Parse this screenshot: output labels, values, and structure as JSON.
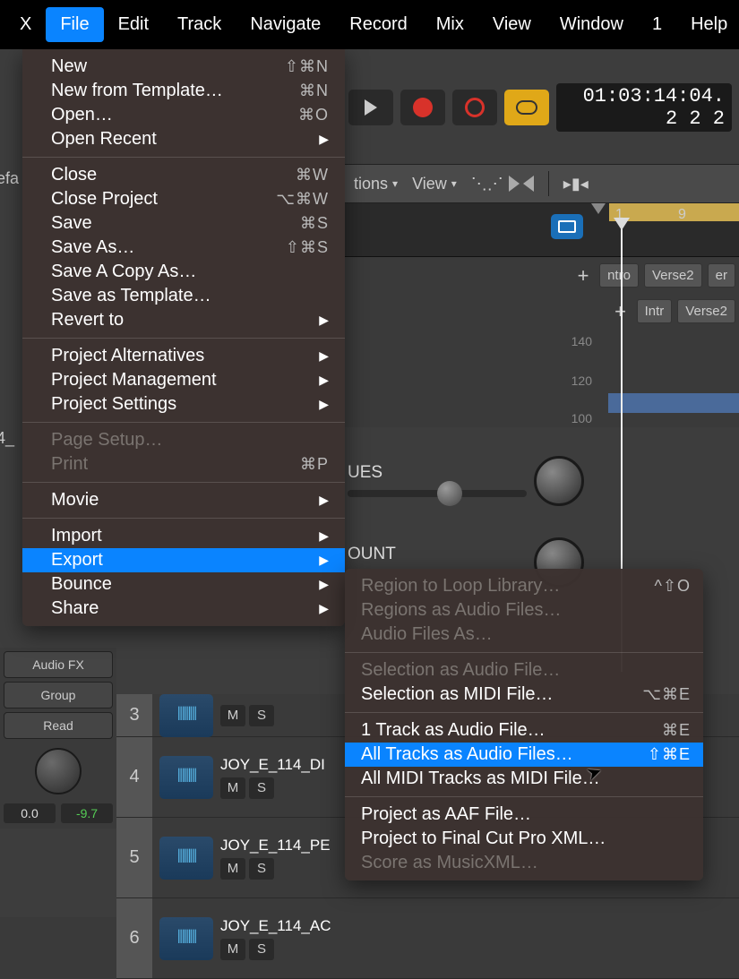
{
  "menubar": {
    "items": [
      "X",
      "File",
      "Edit",
      "Track",
      "Navigate",
      "Record",
      "Mix",
      "View",
      "Window",
      "1",
      "Help"
    ],
    "active_index": 1
  },
  "file_menu": {
    "groups": [
      [
        {
          "label": "New",
          "shortcut": "⇧⌘N"
        },
        {
          "label": "New from Template…",
          "shortcut": "⌘N"
        },
        {
          "label": "Open…",
          "shortcut": "⌘O"
        },
        {
          "label": "Open Recent",
          "submenu": true
        }
      ],
      [
        {
          "label": "Close",
          "shortcut": "⌘W"
        },
        {
          "label": "Close Project",
          "shortcut": "⌥⌘W"
        },
        {
          "label": "Save",
          "shortcut": "⌘S"
        },
        {
          "label": "Save As…",
          "shortcut": "⇧⌘S"
        },
        {
          "label": "Save A Copy As…"
        },
        {
          "label": "Save as Template…"
        },
        {
          "label": "Revert to",
          "submenu": true
        }
      ],
      [
        {
          "label": "Project Alternatives",
          "submenu": true
        },
        {
          "label": "Project Management",
          "submenu": true
        },
        {
          "label": "Project Settings",
          "submenu": true
        }
      ],
      [
        {
          "label": "Page Setup…",
          "disabled": true
        },
        {
          "label": "Print",
          "shortcut": "⌘P",
          "disabled": true
        }
      ],
      [
        {
          "label": "Movie",
          "submenu": true
        }
      ],
      [
        {
          "label": "Import",
          "submenu": true
        },
        {
          "label": "Export",
          "submenu": true,
          "highlighted": true
        },
        {
          "label": "Bounce",
          "submenu": true
        },
        {
          "label": "Share",
          "submenu": true
        }
      ]
    ]
  },
  "export_submenu": {
    "groups": [
      [
        {
          "label": "Region to Loop Library…",
          "shortcut": "^⇧O",
          "disabled": true
        },
        {
          "label": "Regions as Audio Files…",
          "disabled": true
        },
        {
          "label": "Audio Files As…",
          "disabled": true
        }
      ],
      [
        {
          "label": "Selection as Audio File…",
          "disabled": true
        },
        {
          "label": "Selection as MIDI File…",
          "shortcut": "⌥⌘E"
        }
      ],
      [
        {
          "label": "1 Track as Audio File…",
          "shortcut": "⌘E"
        },
        {
          "label": "All Tracks as Audio Files…",
          "shortcut": "⇧⌘E",
          "highlighted": true
        },
        {
          "label": "All MIDI Tracks as MIDI File…"
        }
      ],
      [
        {
          "label": "Project as AAF File…"
        },
        {
          "label": "Project to Final Cut Pro XML…"
        },
        {
          "label": "Score as MusicXML…",
          "disabled": true
        }
      ]
    ]
  },
  "timecode": {
    "main": "01:03:14:04.",
    "sub": "2  2  2"
  },
  "toolbar": {
    "functions_label": "tions",
    "view_label": "View"
  },
  "ruler": {
    "markers": [
      {
        "pos": 300,
        "label": "1"
      },
      {
        "pos": 370,
        "label": "9"
      }
    ]
  },
  "regions": {
    "row1": [
      "ntro",
      "Verse2",
      "er"
    ],
    "row2": [
      "Intr",
      "Verse2"
    ]
  },
  "gain_markers": [
    "140",
    "120",
    "100"
  ],
  "section_labels": {
    "ues": "UES",
    "ount": "OUNT"
  },
  "left_partial": {
    "efa": "efa",
    "track_prefix": "4_"
  },
  "tracks": [
    {
      "num": "3",
      "name": "",
      "m": "M",
      "s": "S"
    },
    {
      "num": "4",
      "name": "JOY_E_114_DI",
      "m": "M",
      "s": "S"
    },
    {
      "num": "5",
      "name": "JOY_E_114_PE",
      "m": "M",
      "s": "S"
    },
    {
      "num": "6",
      "name": "JOY_E_114_AC",
      "m": "M",
      "s": "S"
    }
  ],
  "inspector": {
    "audio_fx": "Audio FX",
    "group": "Group",
    "read": "Read",
    "val1": "0.0",
    "val2": "-9.7"
  }
}
